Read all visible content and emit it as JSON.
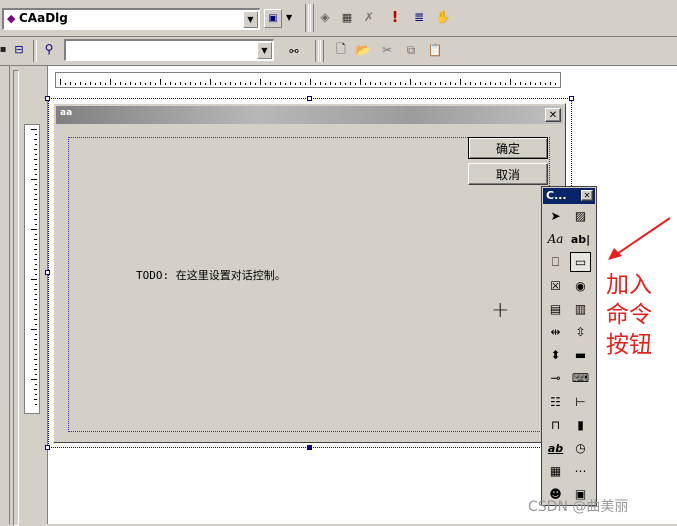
{
  "toolbar1": {
    "class_combo_value": "CAaDlg",
    "buttons": [
      "build-icon",
      "compile-icon",
      "stop-icon",
      "execute-icon",
      "breakpoint-icon",
      "hand-icon"
    ]
  },
  "toolbar2": {
    "find_combo_value": "",
    "buttons": [
      "new-file-icon",
      "open-folder-icon",
      "cut-icon",
      "copy-icon",
      "paste-icon"
    ]
  },
  "dialog": {
    "title": "aa",
    "close_glyph": "✕",
    "ok_label": "确定",
    "cancel_label": "取消",
    "todo_text": "TODO: 在这里设置对话控制。",
    "crosshair": "+"
  },
  "controls_palette": {
    "title": "C...",
    "close_glyph": "✕",
    "tools": [
      [
        "pointer-tool-icon",
        "picture-tool-icon"
      ],
      [
        "static-text-tool-icon",
        "edit-box-tool-icon"
      ],
      [
        "group-box-tool-icon",
        "button-tool-icon"
      ],
      [
        "check-box-tool-icon",
        "radio-button-tool-icon"
      ],
      [
        "combo-box-tool-icon",
        "list-box-tool-icon"
      ],
      [
        "h-scrollbar-tool-icon",
        "v-scrollbar-tool-icon"
      ],
      [
        "spin-tool-icon",
        "progress-tool-icon"
      ],
      [
        "slider-tool-icon",
        "hotkey-tool-icon"
      ],
      [
        "list-control-tool-icon",
        "tree-control-tool-icon"
      ],
      [
        "tab-control-tool-icon",
        "animate-tool-icon"
      ],
      [
        "rich-edit-tool-icon",
        "date-time-tool-icon"
      ],
      [
        "month-calendar-tool-icon",
        "ip-address-tool-icon"
      ],
      [
        "custom-control-tool-icon",
        "extended-combo-tool-icon"
      ]
    ],
    "text_glyphs": {
      "static": "Aa",
      "edit": "ab|",
      "richedit": "ab",
      "group": "xyz"
    }
  },
  "annotation": {
    "text_lines": [
      "加入",
      "命令",
      "按钮"
    ],
    "color": "#e8201c"
  },
  "watermark": "CSDN @曲美丽"
}
